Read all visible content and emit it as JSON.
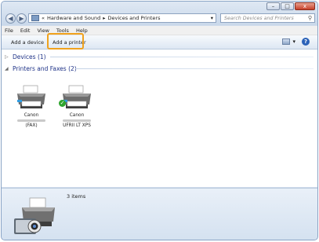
{
  "window": {
    "controls": {
      "minimize": "–",
      "maximize": "□",
      "close": "x"
    }
  },
  "nav": {
    "back_icon": "arrow-left-icon",
    "forward_icon": "arrow-right-icon",
    "address": {
      "sep1": "«",
      "crumb1": "Hardware and Sound",
      "sep2": "▸",
      "crumb2": "Devices and Printers",
      "dropdown": "▾"
    },
    "refresh": "↻",
    "search_placeholder": "Search Devices and Printers"
  },
  "menu": [
    "File",
    "Edit",
    "View",
    "Tools",
    "Help"
  ],
  "toolbar": {
    "add_device": "Add a device",
    "add_printer": "Add a printer",
    "view_dropdown": "▾",
    "help": "?"
  },
  "groups": {
    "devices": {
      "label": "Devices (1)",
      "chevron": "▷"
    },
    "printers": {
      "label": "Printers and Faxes (2)",
      "chevron": "◢"
    }
  },
  "printers": [
    {
      "brand": "Canon",
      "name": "(FAX)",
      "default": false
    },
    {
      "brand": "Canon",
      "name": "UFRII LT XPS",
      "default": true
    }
  ],
  "details": {
    "count": "3 items"
  },
  "colors": {
    "accent_highlight": "#f0a21d",
    "group_text": "#1e3287",
    "default_check": "#2ea52e"
  }
}
